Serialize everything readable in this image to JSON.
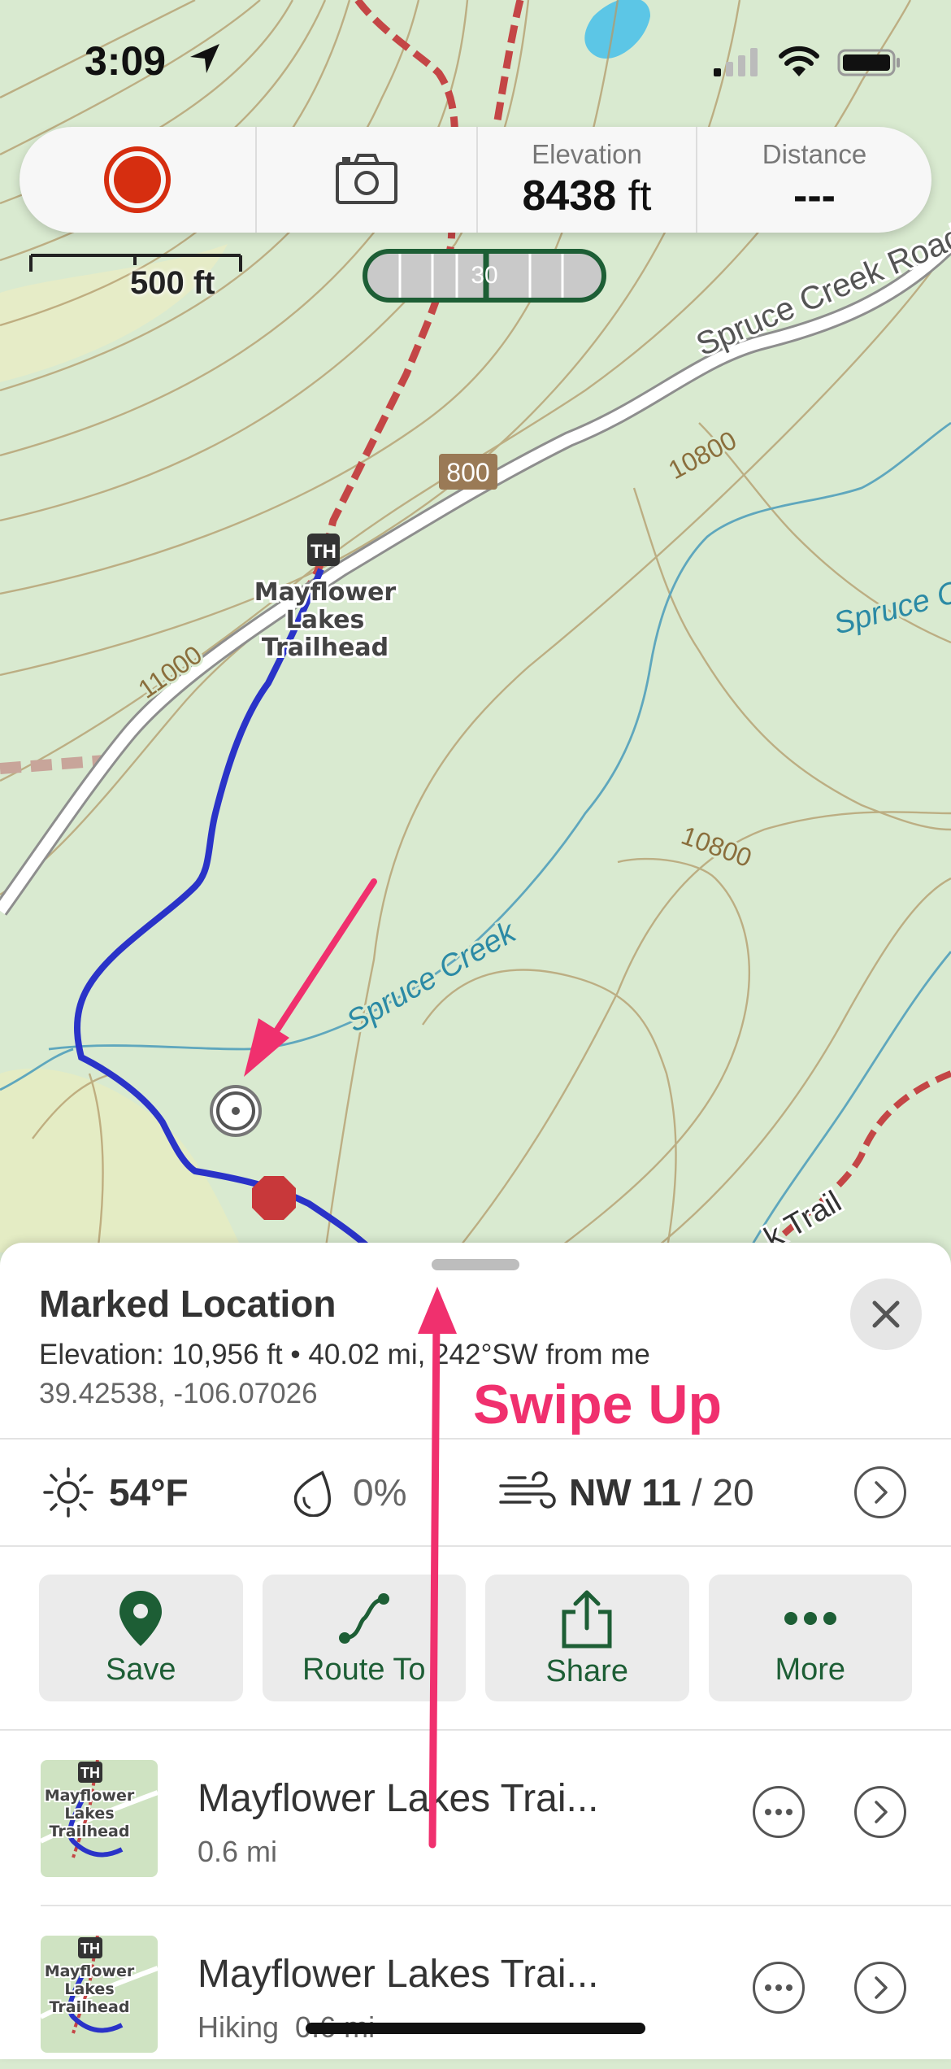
{
  "status_bar": {
    "time": "3:09"
  },
  "toolbar": {
    "elevation_label": "Elevation",
    "elevation_value": "8438",
    "elevation_unit": "ft",
    "distance_label": "Distance",
    "distance_value": "---"
  },
  "map": {
    "scale_label": "500 ft",
    "slider_label": "30",
    "road_name": "Spruce Creek Road",
    "road_number": "800",
    "creek_name": "Spruce Creek",
    "creek_name_2": "Spruce C",
    "contour_labels": [
      "10800",
      "10800",
      "11000"
    ],
    "trailhead_badge": "TH",
    "trailhead_name_lines": [
      "Mayflower",
      "Lakes",
      "Trailhead"
    ],
    "trail_label": "k Trail",
    "route_color": "#2a33c8",
    "map_bg_color": "#d9ead0"
  },
  "sheet": {
    "title": "Marked Location",
    "info_line": "Elevation: 10,956 ft • 40.02 mi, 242°SW from me",
    "coordinates": "39.42538, -106.07026",
    "weather": {
      "temperature": "54°F",
      "precipitation": "0%",
      "wind_dir_speed": "NW 11",
      "wind_gust": " / 20"
    },
    "actions": [
      {
        "label": "Save",
        "icon": "pin-icon"
      },
      {
        "label": "Route To",
        "icon": "route-icon"
      },
      {
        "label": "Share",
        "icon": "share-icon"
      },
      {
        "label": "More",
        "icon": "more-icon"
      }
    ],
    "results": [
      {
        "title": "Mayflower Lakes Trai...",
        "subtitle": "0.6 mi",
        "thumb_badge": "TH",
        "thumb_name": [
          "Mayflower",
          "Lakes",
          "Trailhead"
        ]
      },
      {
        "title": "Mayflower Lakes Trai...",
        "subtitle": "Hiking  0.6 mi",
        "thumb_badge": "TH",
        "thumb_name": [
          "Mayflower",
          "Lakes",
          "Trailhead"
        ]
      }
    ],
    "accent_color": "#1d5e35"
  },
  "annotation": {
    "text": "Swipe Up",
    "color": "#f0306e"
  }
}
